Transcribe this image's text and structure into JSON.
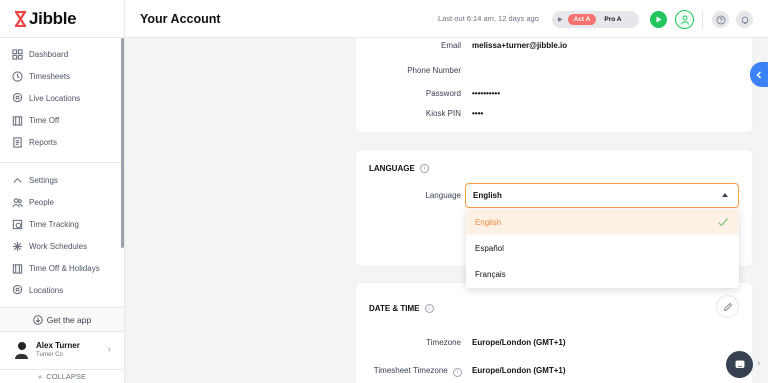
{
  "app": {
    "logo_text": "Jibble"
  },
  "sidebar": {
    "items_top": [
      {
        "label": "Dashboard",
        "icon": "dashboard-icon"
      },
      {
        "label": "Timesheets",
        "icon": "clock-icon"
      },
      {
        "label": "Live Locations",
        "icon": "location-pin-icon"
      },
      {
        "label": "Time Off",
        "icon": "calendar-icon"
      },
      {
        "label": "Reports",
        "icon": "report-icon"
      }
    ],
    "items_settings": [
      {
        "label": "Settings",
        "icon": "chevron-up-icon"
      },
      {
        "label": "People",
        "icon": "people-icon"
      },
      {
        "label": "Time Tracking",
        "icon": "time-tracking-icon"
      },
      {
        "label": "Work Schedules",
        "icon": "schedule-icon"
      },
      {
        "label": "Time Off & Holidays",
        "icon": "calendar-icon"
      },
      {
        "label": "Locations",
        "icon": "location-pin-icon"
      }
    ],
    "get_app": "Get the app",
    "user": {
      "name": "Alex Turner",
      "company": "Turner Co"
    },
    "collapse": "COLLAPSE"
  },
  "header": {
    "title": "Your Account",
    "last_out": "Last out 6:14 am, 12 days ago",
    "activity": "Act A",
    "project": "Pro A"
  },
  "account": {
    "email_label": "Email",
    "email_value": "melissa+turner@jibble.io",
    "phone_label": "Phone Number",
    "phone_value": "",
    "password_label": "Password",
    "password_value": "••••••••••",
    "pin_label": "Kiosk PIN",
    "pin_value": "••••"
  },
  "language": {
    "section_title": "LANGUAGE",
    "label": "Language",
    "selected": "English",
    "options": [
      "English",
      "Español",
      "Français"
    ]
  },
  "datetime": {
    "section_title": "DATE & TIME",
    "timezone_label": "Timezone",
    "timezone_value": "Europe/London (GMT+1)",
    "timesheet_tz_label": "Timesheet Timezone",
    "timesheet_tz_value": "Europe/London (GMT+1)"
  },
  "colors": {
    "accent_orange": "#f59e42",
    "primary_green": "#22c55e",
    "activity_red": "#f87171",
    "side_tab_blue": "#3b82f6"
  }
}
